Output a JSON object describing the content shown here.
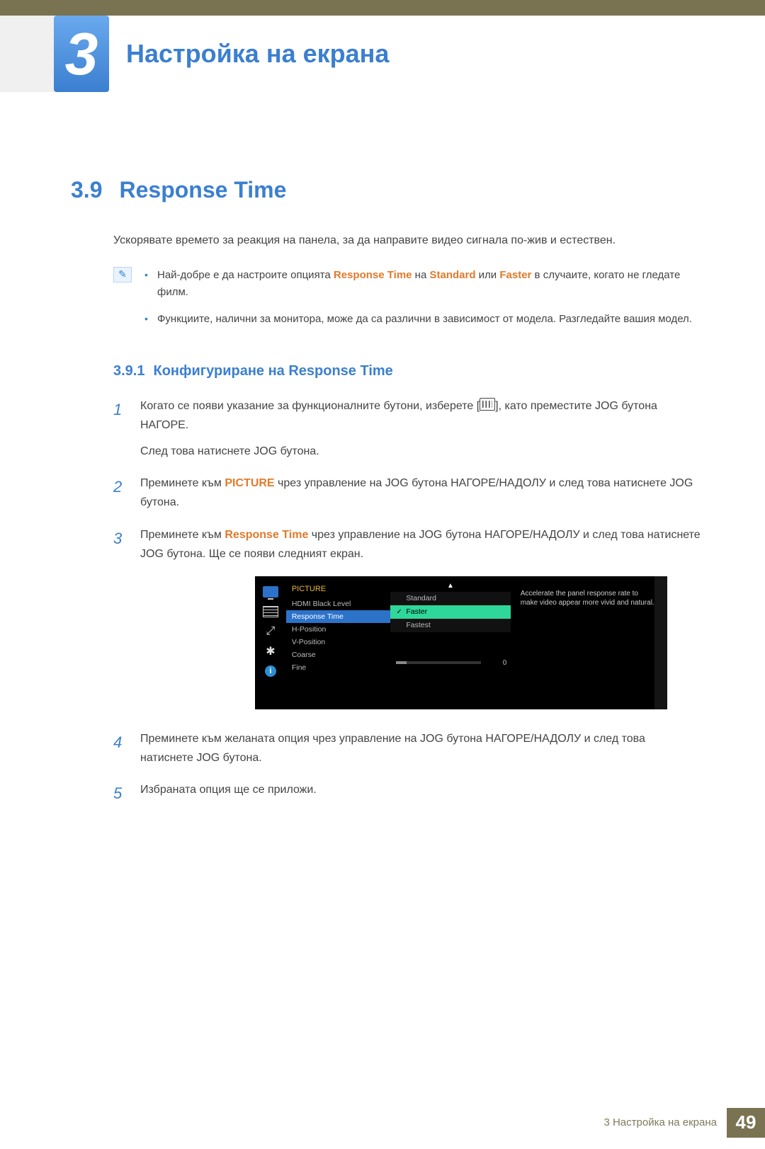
{
  "chapter": {
    "number": "3",
    "title": "Настройка на екрана"
  },
  "section": {
    "number": "3.9",
    "title": "Response Time"
  },
  "intro": "Ускорявате времето за реакция на панела, за да направите видео сигнала по-жив и естествен.",
  "notes": {
    "b1a": "Най-добре е да настроите опцията ",
    "b1_rt": "Response Time",
    "b1b": " на ",
    "b1_std": "Standard",
    "b1c": " или ",
    "b1_fast": "Faster",
    "b1d": " в случаите, когато не гледате филм.",
    "b2": "Функциите, налични за монитора, може да са различни в зависимост от модела. Разгледайте вашия модел."
  },
  "subsection": {
    "number": "3.9.1",
    "title": "Конфигуриране на Response Time"
  },
  "steps": {
    "s1a": "Когато се появи указание за функционалните бутони, изберете [",
    "s1b": "], като преместите JOG бутона НАГОРЕ.",
    "s1c": "След това натиснете JOG бутона.",
    "s2a": "Преминете към ",
    "s2_pic": "PICTURE",
    "s2b": " чрез управление на JOG бутона НАГОРЕ/НАДОЛУ и след това натиснете JOG бутона.",
    "s3a": "Преминете към ",
    "s3_rt": "Response Time",
    "s3b": " чрез управление на JOG бутона НАГОРЕ/НАДОЛУ и след това натиснете JOG бутона. Ще се появи следният екран.",
    "s4": "Преминете към желаната опция чрез управление на JOG бутона НАГОРЕ/НАДОЛУ и след това натиснете JOG бутона.",
    "s5": "Избраната опция ще се приложи."
  },
  "osd": {
    "menu_title": "PICTURE",
    "items": [
      "HDMI Black Level",
      "Response Time",
      "H-Position",
      "V-Position",
      "Coarse",
      "Fine"
    ],
    "options": [
      "Standard",
      "Faster",
      "Fastest"
    ],
    "slider_value": "0",
    "description": "Accelerate the panel response rate to make video appear more vivid and natural."
  },
  "footer": {
    "text": "3 Настройка на екрана",
    "page": "49"
  }
}
